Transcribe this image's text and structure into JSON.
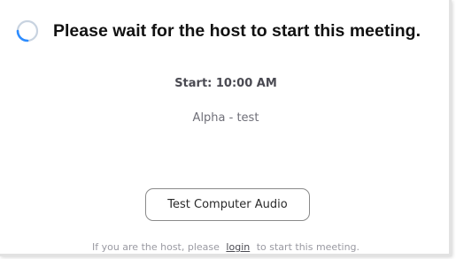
{
  "header": {
    "title": "Please wait for the host to start this meeting.",
    "spinner_icon": "loading-spinner-icon"
  },
  "meeting": {
    "start_time": "Start: 10:00 AM",
    "name": "Alpha - test"
  },
  "actions": {
    "test_audio_label": "Test Computer Audio"
  },
  "footer": {
    "prefix": "If you are the host, please",
    "login_link": "login",
    "suffix": "to start this meeting."
  },
  "colors": {
    "spinner_track": "#c8d3e0",
    "spinner_accent": "#2d8cff"
  }
}
